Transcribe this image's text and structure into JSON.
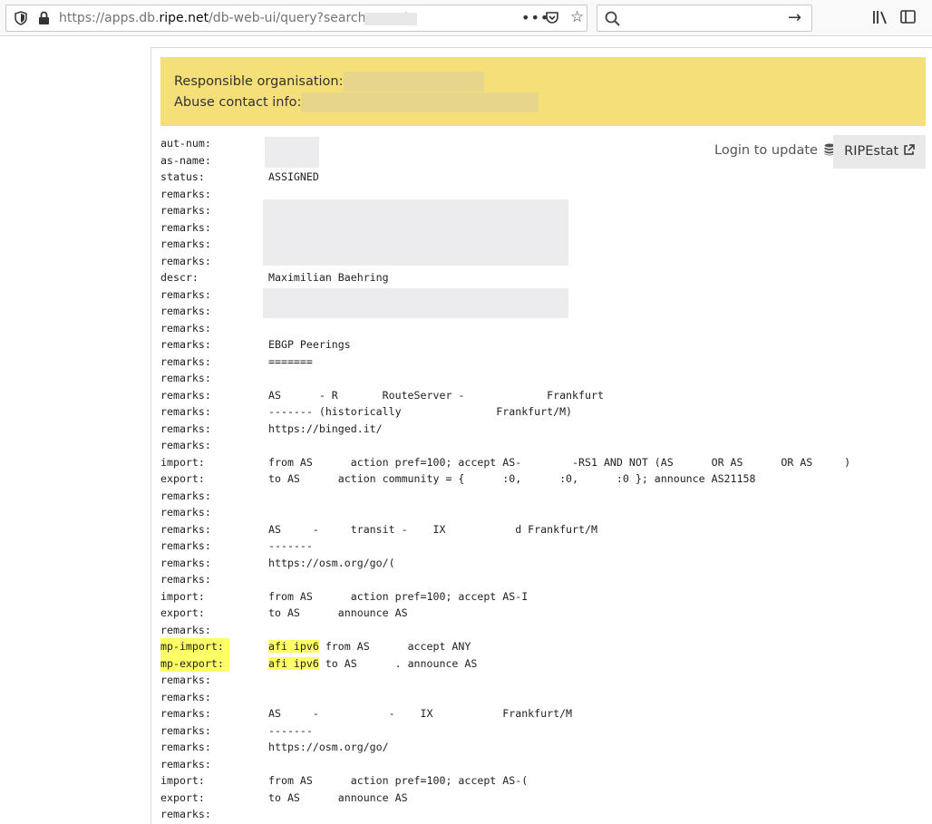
{
  "browser": {
    "url_prefix": "https://apps.db.",
    "url_domain": "ripe.net",
    "url_rest": "/db-web-ui/query?searchtext=A"
  },
  "banner": {
    "responsible_label": "Responsible organisation:",
    "abuse_label": "Abuse contact info:"
  },
  "actions": {
    "login_label": "Login to update",
    "ripestat_label": "RIPEstat"
  },
  "records": [
    {
      "key": "aut-num:",
      "value": ""
    },
    {
      "key": "as-name:",
      "value": ""
    },
    {
      "key": "status:",
      "value": "ASSIGNED"
    },
    {
      "key": "remarks:",
      "value": ""
    },
    {
      "key": "remarks:",
      "value": ""
    },
    {
      "key": "remarks:",
      "value": ""
    },
    {
      "key": "remarks:",
      "value": ""
    },
    {
      "key": "remarks:",
      "value": ""
    },
    {
      "key": "descr:",
      "value": "Maximilian Baehring"
    },
    {
      "key": "remarks:",
      "value": ""
    },
    {
      "key": "remarks:",
      "value": ""
    },
    {
      "key": "remarks:",
      "value": ""
    },
    {
      "key": "remarks:",
      "value": "EBGP Peerings"
    },
    {
      "key": "remarks:",
      "value": "======="
    },
    {
      "key": "remarks:",
      "value": ""
    },
    {
      "key": "remarks:",
      "value": "AS      - R       RouteServer -             Frankfurt"
    },
    {
      "key": "remarks:",
      "value": "------- (historically               Frankfurt/M)"
    },
    {
      "key": "remarks:",
      "value": "https://binged.it/"
    },
    {
      "key": "remarks:",
      "value": ""
    },
    {
      "key": "import:",
      "value": "from AS      action pref=100; accept AS-        -RS1 AND NOT (AS      OR AS      OR AS     )"
    },
    {
      "key": "export:",
      "value": "to AS      action community = {      :0,      :0,      :0 }; announce AS21158"
    },
    {
      "key": "remarks:",
      "value": ""
    },
    {
      "key": "remarks:",
      "value": ""
    },
    {
      "key": "remarks:",
      "value": "AS     -     transit -    IX           d Frankfurt/M"
    },
    {
      "key": "remarks:",
      "value": "-------"
    },
    {
      "key": "remarks:",
      "value": "https://osm.org/go/("
    },
    {
      "key": "remarks:",
      "value": ""
    },
    {
      "key": "import:",
      "value": "from AS      action pref=100; accept AS-I"
    },
    {
      "key": "export:",
      "value": "to AS      announce AS"
    },
    {
      "key": "remarks:",
      "value": ""
    },
    {
      "key": "mp-import:",
      "value": " from AS      accept ANY",
      "hl": "afi ipv6"
    },
    {
      "key": "mp-export:",
      "value": " to AS      . announce AS",
      "hl": "afi ipv6"
    },
    {
      "key": "remarks:",
      "value": ""
    },
    {
      "key": "remarks:",
      "value": ""
    },
    {
      "key": "remarks:",
      "value": "AS     -           -    IX           Frankfurt/M"
    },
    {
      "key": "remarks:",
      "value": "-------"
    },
    {
      "key": "remarks:",
      "value": "https://osm.org/go/"
    },
    {
      "key": "remarks:",
      "value": ""
    },
    {
      "key": "import:",
      "value": "from AS      action pref=100; accept AS-("
    },
    {
      "key": "export:",
      "value": "to AS      announce AS"
    },
    {
      "key": "remarks:",
      "value": ""
    }
  ]
}
